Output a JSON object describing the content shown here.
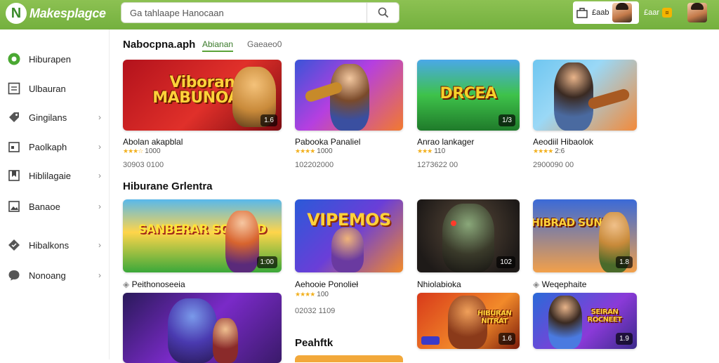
{
  "app": {
    "logo_letter": "N",
    "name": "Makesplagce",
    "accent": "#74b03e"
  },
  "search": {
    "placeholder": "Ga tahlaape Hanocaan"
  },
  "user1": {
    "label": "£aab"
  },
  "user2": {
    "label": "£aar"
  },
  "sidebar": {
    "items": [
      {
        "label": "Hiburapen",
        "icon": "gamepad-icon",
        "chevron": false
      },
      {
        "label": "Ulbauran",
        "icon": "list-icon",
        "chevron": false
      },
      {
        "label": "Gingilans",
        "icon": "tag-icon",
        "chevron": true
      },
      {
        "label": "Paolkaph",
        "icon": "calendar-icon",
        "chevron": true
      },
      {
        "label": "Hiblilagaie",
        "icon": "bookmark-icon",
        "chevron": true
      },
      {
        "label": "Banaoe",
        "icon": "image-icon",
        "chevron": true
      },
      {
        "label": "Hibalkons",
        "icon": "diamond-icon",
        "chevron": true
      },
      {
        "label": "Nonoang",
        "icon": "chat-icon",
        "chevron": true
      }
    ]
  },
  "section1": {
    "title": "Nabocpna.aph",
    "tabs": [
      "Abianan",
      "Gaeaeo0"
    ]
  },
  "section2": {
    "title": "Hiburane Grlentra"
  },
  "section3": {
    "title": "Peahftk"
  },
  "row1": [
    {
      "art": "Viboran MABUNOAN",
      "badge": "1.6",
      "title": "Abolan akapblal",
      "rating": "1000",
      "meta": "30903 0100"
    },
    {
      "art": "",
      "badge": "",
      "title": "Pabooka Panaliel",
      "rating": "1000",
      "meta": "102202000"
    },
    {
      "art": "DRCEA",
      "badge": "1/3",
      "title": "Anrao lankager",
      "rating": "110",
      "meta": "1273622 00"
    },
    {
      "art": "",
      "badge": "",
      "title": "Aeodiil Hibaolok",
      "rating": "2:6",
      "meta": "2900090 00"
    }
  ],
  "row2": [
    {
      "art": "SANBERAR SORBUD",
      "badge": "1:00",
      "title": "Peithonoseeia",
      "rating": "",
      "meta": ""
    },
    {
      "art": "VIPEMOS",
      "badge": "",
      "title": "Aehooie Ponolieł",
      "rating": "100",
      "meta": "02032 1109"
    },
    {
      "art": "",
      "badge": "102",
      "title": "Nhiolabioka",
      "rating": "",
      "meta": ""
    },
    {
      "art": "HIBRAD SUNNS",
      "badge": "1.8",
      "title": "Weqephaite",
      "rating": "",
      "meta": ""
    }
  ],
  "row3": [
    {
      "art": "",
      "badge": ""
    },
    {
      "art": "HIBURAN NITRAT",
      "badge": "1.6"
    },
    {
      "art": "SEIRAN ROCNEET",
      "badge": "1.9"
    }
  ]
}
